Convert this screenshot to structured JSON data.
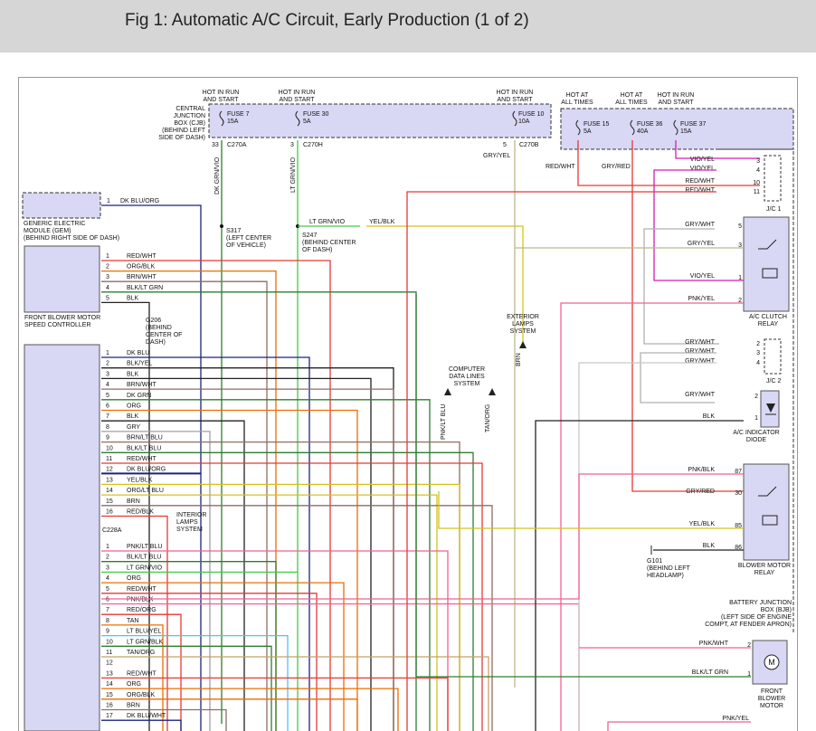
{
  "title": "Fig 1: Automatic A/C Circuit, Early Production (1 of 2)",
  "colors": {
    "header_bg": "#d6d6d6",
    "module_fill": "#d8d8f5",
    "DK BLU": "#1a237e",
    "BLK": "#222222",
    "RED": "#e53935",
    "ORG": "#ef6c00",
    "BRN": "#8d6e63",
    "GRN": "#2e7d32",
    "YEL": "#d4c21a",
    "GRY": "#a0a0a0",
    "LT GRN": "#43c94a",
    "LT BLU": "#4fc3f7",
    "TAN": "#c8a06a",
    "PNK": "#f06292",
    "VIO": "#d81bb0"
  },
  "labels": [
    {
      "id": "hot-run-1",
      "lines": [
        "HOT IN RUN",
        "AND START"
      ]
    },
    {
      "id": "hot-run-2",
      "lines": [
        "HOT IN RUN",
        "AND START"
      ]
    },
    {
      "id": "hot-run-3",
      "lines": [
        "HOT IN RUN",
        "AND START"
      ]
    },
    {
      "id": "hot-all-1",
      "lines": [
        "HOT AT",
        "ALL TIMES"
      ]
    },
    {
      "id": "hot-all-2",
      "lines": [
        "HOT AT",
        "ALL TIMES"
      ]
    },
    {
      "id": "hot-run-4",
      "lines": [
        "HOT IN RUN",
        "AND START"
      ]
    },
    {
      "id": "cjb",
      "lines": [
        "CENTRAL",
        "JUNCTION",
        "BOX (CJB)",
        "(BEHIND LEFT",
        "SIDE OF DASH)"
      ]
    },
    {
      "id": "fuse7",
      "lines": [
        "FUSE 7",
        "15A"
      ]
    },
    {
      "id": "fuse30",
      "lines": [
        "FUSE 30",
        "5A"
      ]
    },
    {
      "id": "fuse10",
      "lines": [
        "FUSE 10",
        "10A"
      ]
    },
    {
      "id": "fuse15",
      "lines": [
        "FUSE 15",
        "5A"
      ]
    },
    {
      "id": "fuse36",
      "lines": [
        "FUSE 36",
        "40A"
      ]
    },
    {
      "id": "fuse37",
      "lines": [
        "FUSE 37",
        "15A"
      ]
    },
    {
      "id": "c270a",
      "lines": [
        "C270A"
      ]
    },
    {
      "id": "c270h",
      "lines": [
        "C270H"
      ]
    },
    {
      "id": "c270b",
      "lines": [
        "C270B"
      ]
    },
    {
      "id": "pin33",
      "lines": [
        "33"
      ]
    },
    {
      "id": "pin3",
      "lines": [
        "3"
      ]
    },
    {
      "id": "pin5",
      "lines": [
        "5"
      ]
    },
    {
      "id": "w-gryyel",
      "lines": [
        "GRY/YEL"
      ]
    },
    {
      "id": "w-redwht",
      "lines": [
        "RED/WHT"
      ]
    },
    {
      "id": "w-gryred",
      "lines": [
        "GRY/RED"
      ]
    },
    {
      "id": "w-dkgrnvio",
      "lines": [
        "DK GRN/VIO"
      ]
    },
    {
      "id": "w-ltgrnvio-v",
      "lines": [
        "LT GRN/VIO"
      ]
    },
    {
      "id": "s317",
      "lines": [
        "S317",
        "(LEFT CENTER",
        "OF VEHICLE)"
      ]
    },
    {
      "id": "s247",
      "lines": [
        "S247",
        "(BEHIND CENTER",
        "OF DASH)"
      ]
    },
    {
      "id": "w-ltgrnvio-h",
      "lines": [
        "LT GRN/VIO"
      ]
    },
    {
      "id": "w-yelblk",
      "lines": [
        "YEL/BLK"
      ]
    },
    {
      "id": "gem",
      "lines": [
        "GENERIC ELECTRIC",
        "MODULE (GEM)",
        "(BEHIND RIGHT SIDE OF DASH)"
      ]
    },
    {
      "id": "gem-pin",
      "lines": [
        "1"
      ]
    },
    {
      "id": "gem-wire",
      "lines": [
        "DK BLU/ORG"
      ]
    },
    {
      "id": "fbmsc",
      "lines": [
        "FRONT BLOWER MOTOR",
        "SPEED CONTROLLER"
      ]
    },
    {
      "id": "g206",
      "lines": [
        "G206",
        "(BEHIND",
        "CENTER OF",
        "DASH)"
      ]
    },
    {
      "id": "ext-lamps",
      "lines": [
        "EXTERIOR",
        "LAMPS",
        "SYSTEM"
      ]
    },
    {
      "id": "w-brn-v",
      "lines": [
        "BRN"
      ]
    },
    {
      "id": "comp-data",
      "lines": [
        "COMPUTER",
        "DATA LINES",
        "SYSTEM"
      ]
    },
    {
      "id": "w-pnkltblu-v",
      "lines": [
        "PNK/LT BLU"
      ]
    },
    {
      "id": "w-tanorg-v",
      "lines": [
        "TAN/ORG"
      ]
    },
    {
      "id": "int-lamps",
      "lines": [
        "INTERIOR",
        "LAMPS",
        "SYSTEM"
      ]
    },
    {
      "id": "c228a",
      "lines": [
        "C228A"
      ]
    },
    {
      "id": "jc1",
      "lines": [
        "J/C 1"
      ]
    },
    {
      "id": "ac-clutch",
      "lines": [
        "A/C CLUTCH",
        "RELAY"
      ]
    },
    {
      "id": "jc2",
      "lines": [
        "J/C 2"
      ]
    },
    {
      "id": "ac-diode",
      "lines": [
        "A/C INDICATOR",
        "DIODE"
      ]
    },
    {
      "id": "blower-relay",
      "lines": [
        "BLOWER MOTOR",
        "RELAY"
      ]
    },
    {
      "id": "g101",
      "lines": [
        "G101",
        "(BEHIND LEFT",
        "HEADLAMP)"
      ]
    },
    {
      "id": "bjb",
      "lines": [
        "BATTERY JUNCTION",
        "BOX (BJB)",
        "(LEFT SIDE OF ENGINE",
        "COMPT, AT FENDER APRON)"
      ]
    },
    {
      "id": "fbm",
      "lines": [
        "FRONT",
        "BLOWER",
        "MOTOR"
      ]
    },
    {
      "id": "motor-m",
      "lines": [
        "M"
      ]
    }
  ],
  "pins": [
    {
      "id": "fbmsc",
      "items": [
        [
          "1",
          "RED/WHT"
        ],
        [
          "2",
          "ORG/BLK"
        ],
        [
          "3",
          "BRN/WHT"
        ],
        [
          "4",
          "BLK/LT GRN"
        ],
        [
          "5",
          "BLK"
        ]
      ]
    },
    {
      "id": "ctrl1",
      "items": [
        [
          "1",
          "DK BLU"
        ],
        [
          "2",
          "BLK/YEL"
        ],
        [
          "3",
          "BLK"
        ],
        [
          "4",
          "BRN/WHT"
        ],
        [
          "5",
          "DK GRN"
        ],
        [
          "6",
          "ORG"
        ],
        [
          "7",
          "BLK"
        ],
        [
          "8",
          "GRY"
        ],
        [
          "9",
          "BRN/LT BLU"
        ],
        [
          "10",
          "BLK/LT BLU"
        ],
        [
          "11",
          "RED/WHT"
        ],
        [
          "12",
          "DK BLU/ORG"
        ],
        [
          "13",
          "YEL/BLK"
        ],
        [
          "14",
          "ORG/LT BLU"
        ],
        [
          "15",
          "BRN"
        ],
        [
          "16",
          "RED/BLK"
        ]
      ]
    },
    {
      "id": "ctrl2",
      "items": [
        [
          "1",
          "PNK/LT BLU"
        ],
        [
          "2",
          "BLK/LT BLU"
        ],
        [
          "3",
          "LT GRN/VIO"
        ],
        [
          "4",
          "ORG"
        ],
        [
          "5",
          "RED/WHT"
        ],
        [
          "6",
          "PNK/BLK"
        ],
        [
          "7",
          "RED/ORG"
        ],
        [
          "8",
          "TAN"
        ],
        [
          "9",
          "LT BLU/YEL"
        ],
        [
          "10",
          "LT GRN/BLK"
        ],
        [
          "11",
          "TAN/ORG"
        ],
        [
          "12",
          ""
        ],
        [
          "13",
          "RED/WHT"
        ],
        [
          "14",
          "ORG"
        ],
        [
          "15",
          "ORG/BLK"
        ],
        [
          "16",
          "BRN"
        ],
        [
          "17",
          "DK BLU/WHT"
        ]
      ]
    },
    {
      "id": "jc1",
      "items": [
        [
          "3",
          "VIO/YEL"
        ],
        [
          "4",
          "VIO/YEL"
        ],
        [
          "10",
          "RED/WHT"
        ],
        [
          "11",
          "RED/WHT"
        ]
      ]
    },
    {
      "id": "acrelay",
      "items": [
        [
          "5",
          "GRY/WHT"
        ],
        [
          "3",
          "GRY/YEL"
        ],
        [
          "1",
          "VIO/YEL"
        ],
        [
          "2",
          "PNK/YEL"
        ]
      ]
    },
    {
      "id": "jc2",
      "items": [
        [
          "2",
          "GRY/WHT"
        ],
        [
          "3",
          "GRY/WHT"
        ],
        [
          "4",
          "GRY/WHT"
        ]
      ]
    },
    {
      "id": "diode",
      "items": [
        [
          "2",
          "GRY/WHT"
        ],
        [
          "1",
          "BLK"
        ]
      ]
    },
    {
      "id": "brelay",
      "items": [
        [
          "87",
          "PNK/BLK"
        ],
        [
          "30",
          "GRY/RED"
        ],
        [
          "85",
          "YEL/BLK"
        ],
        [
          "86",
          "BLK"
        ]
      ]
    },
    {
      "id": "motor",
      "items": [
        [
          "2",
          "PNK/WHT"
        ],
        [
          "1",
          "BLK/LT GRN"
        ]
      ]
    },
    {
      "id": "bottom",
      "items": [
        [
          "",
          "PNK/YEL"
        ]
      ]
    }
  ]
}
